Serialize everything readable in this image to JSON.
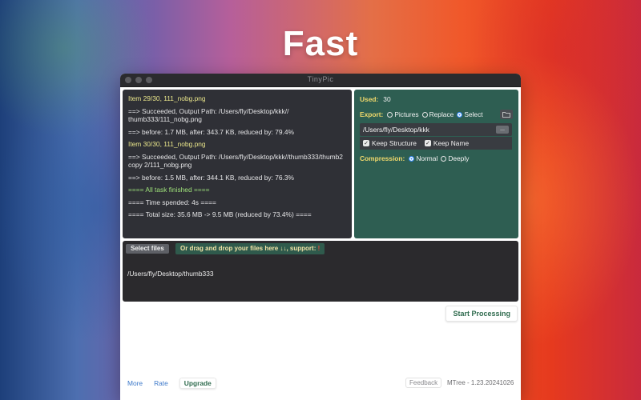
{
  "hero": {
    "title": "Fast"
  },
  "window": {
    "title": "TinyPic"
  },
  "log": [
    {
      "kind": "item",
      "text": "Item 29/30, 111_nobg.png"
    },
    {
      "kind": "normal",
      "text": "==> Succeeded, Output Path: /Users/fly/Desktop/kkk// thumb333/111_nobg.png"
    },
    {
      "kind": "normal",
      "text": "==> before: 1.7 MB, after: 343.7 KB, reduced by: 79.4%"
    },
    {
      "kind": "item",
      "text": "Item 30/30, 111_nobg.png"
    },
    {
      "kind": "normal",
      "text": "==> Succeeded, Output Path: /Users/fly/Desktop/kkk//thumb333/thumb2 copy 2/111_nobg.png"
    },
    {
      "kind": "normal",
      "text": "==> before: 1.5 MB, after: 344.1 KB, reduced by: 76.3%"
    },
    {
      "kind": "done",
      "text": "==== All task finished ===="
    },
    {
      "kind": "normal",
      "text": "==== Time spended: 4s ===="
    },
    {
      "kind": "normal",
      "text": "==== Total size: 35.6 MB -> 9.5 MB (reduced by 73.4%) ===="
    }
  ],
  "settings": {
    "used_label": "Used:",
    "used_value": "30",
    "export_label": "Export:",
    "export_options": [
      "Pictures",
      "Replace",
      "Select"
    ],
    "export_selected": "Select",
    "path": "/Users/fly/Desktop/kkk",
    "dots_label": "...",
    "keep_structure": "Keep Structure",
    "keep_name": "Keep Name",
    "compression_label": "Compression:",
    "compression_options": [
      "Normal",
      "Deeply"
    ],
    "compression_selected": "Normal"
  },
  "drop": {
    "select_files": "Select files",
    "hint": "Or drag and drop your files here ↓↓, support: ",
    "hint_icon": "!",
    "current_path": "/Users/fly/Desktop/thumb333"
  },
  "actions": {
    "start": "Start Processing"
  },
  "footer": {
    "more": "More",
    "rate": "Rate",
    "upgrade": "Upgrade",
    "feedback": "Feedback",
    "version": "MTree - 1.23.20241026"
  }
}
